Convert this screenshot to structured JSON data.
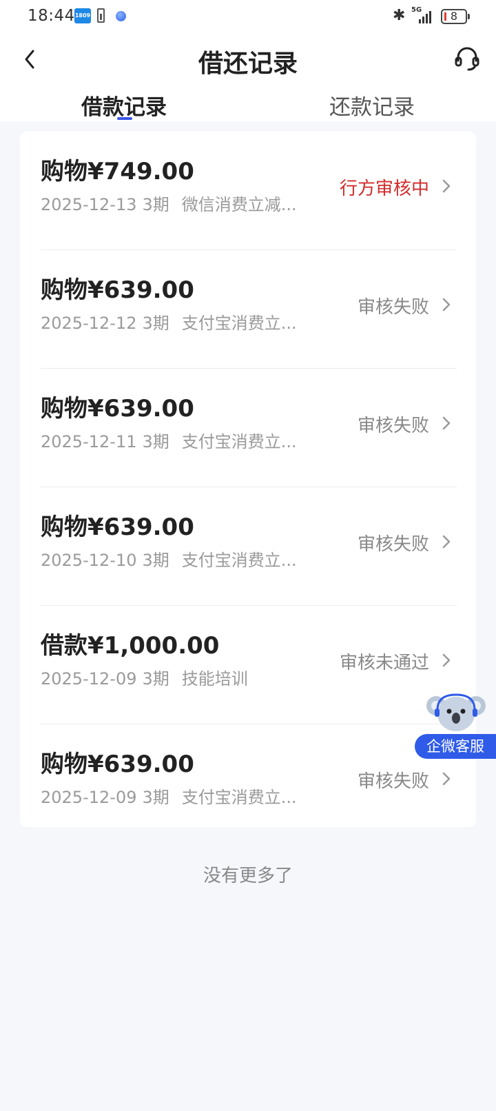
{
  "status_bar": {
    "time": "18:44",
    "hd_badge": "1809",
    "network": "5G",
    "battery": "8"
  },
  "nav": {
    "title": "借还记录"
  },
  "tabs": [
    {
      "label": "借款记录",
      "active": true
    },
    {
      "label": "还款记录",
      "active": false
    }
  ],
  "records": [
    {
      "title": "购物¥749.00",
      "date": "2025-12-13",
      "term": "3期",
      "desc": "微信消费立减...",
      "status": "行方审核中",
      "status_color": "#d32b2b"
    },
    {
      "title": "购物¥639.00",
      "date": "2025-12-12",
      "term": "3期",
      "desc": "支付宝消费立...",
      "status": "审核失败",
      "status_color": "#888888"
    },
    {
      "title": "购物¥639.00",
      "date": "2025-12-11",
      "term": "3期",
      "desc": "支付宝消费立...",
      "status": "审核失败",
      "status_color": "#888888"
    },
    {
      "title": "购物¥639.00",
      "date": "2025-12-10",
      "term": "3期",
      "desc": "支付宝消费立...",
      "status": "审核失败",
      "status_color": "#888888"
    },
    {
      "title": "借款¥1,000.00",
      "date": "2025-12-09",
      "term": "3期",
      "desc": "技能培训",
      "status": "审核未通过",
      "status_color": "#888888"
    },
    {
      "title": "购物¥639.00",
      "date": "2025-12-09",
      "term": "3期",
      "desc": "支付宝消费立...",
      "status": "审核失败",
      "status_color": "#888888"
    }
  ],
  "footer": {
    "no_more": "没有更多了"
  },
  "float_service": {
    "label": "企微客服"
  }
}
